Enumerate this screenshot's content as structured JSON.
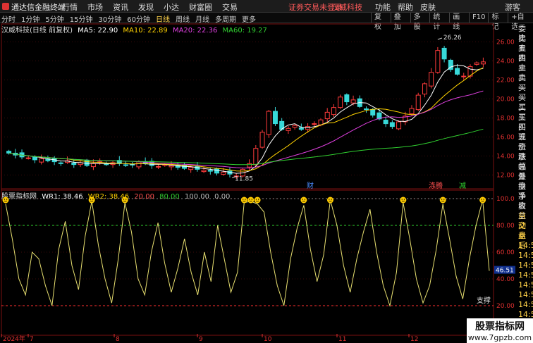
{
  "topbar": {
    "brand": "通达信金融终端",
    "menu": [
      "行情",
      "市场",
      "资讯",
      "发现",
      "小达",
      "财富圈",
      "交易"
    ],
    "notice": "证券交易未登录",
    "stock_name": "汉威科技",
    "right_menu": [
      "功能",
      "帮助",
      "皮肤"
    ],
    "guest": "游客"
  },
  "toolbar": {
    "periods": [
      "分时",
      "1分钟",
      "5分钟",
      "15分钟",
      "30分钟",
      "60分钟",
      "日线",
      "周线",
      "月线",
      "多周期",
      "更多"
    ],
    "active_period": "日线",
    "tools": [
      "复权",
      "叠加",
      "多股",
      "统计",
      "画线",
      "F10",
      "标记",
      "+自选"
    ]
  },
  "main_title": {
    "name": "汉威科技(日线 前复权)",
    "ma5": "MA5: 22.90",
    "ma10": "MA10: 22.89",
    "ma20": "MA20: 22.36",
    "ma60": "MA60: 19.27",
    "ma5_color": "#ffffff",
    "ma10_color": "#ffd200",
    "ma20_color": "#e040e0",
    "ma60_color": "#30d030"
  },
  "osc_title": {
    "name": "股票指标网",
    "wr1": "WR1: 38.46",
    "wr2": "WR2: 38.46",
    "l20": "20.00",
    "l80": "80.00",
    "l100": "100.00",
    "l0": "0.00"
  },
  "axis": {
    "price_ticks": [
      "26.00",
      "24.00",
      "22.00",
      "20.00",
      "18.00",
      "16.00",
      "14.00",
      "12.00"
    ],
    "osc_ticks": [
      "100.0",
      "80.00",
      "60.00",
      "40.00",
      "20.00"
    ],
    "osc_current": "46.51",
    "dates": [
      "2024年",
      "7",
      "8",
      "9",
      "10",
      "11",
      "12"
    ]
  },
  "annotations": {
    "high": "26.26",
    "low": "11.85",
    "cai": "财",
    "chouma": "涤腾",
    "jian": "减",
    "support": "支撑"
  },
  "side_panel": [
    "委比",
    "卖五",
    "卖四",
    "卖三",
    "卖二",
    "卖一",
    "买一",
    "买二",
    "买三",
    "买四",
    "买五",
    "现价",
    "涨跌",
    "涨幅",
    "总量",
    "外盘",
    "换手",
    "净资",
    "收益",
    "自动",
    "交易",
    "盘后",
    "14:5",
    "14:5",
    "14:5",
    "14:5",
    "14:5",
    "14:5",
    "14:5",
    "14:5"
  ],
  "watermark": {
    "line1": "股票指标网",
    "line2": "www.7gpzb.com"
  },
  "chart_data": [
    {
      "type": "candlestick",
      "ylim": [
        11,
        27
      ],
      "x_dates": [
        "2024年",
        "7",
        "8",
        "9",
        "10",
        "11",
        "12"
      ],
      "high": 26.26,
      "low": 11.85,
      "closes": [
        14.3,
        14.1,
        13.9,
        13.8,
        13.6,
        13.7,
        13.5,
        13.4,
        13.2,
        13.5,
        13.1,
        13.3,
        13.0,
        13.2,
        13.4,
        13.1,
        13.3,
        13.2,
        13.0,
        13.1,
        13.4,
        13.2,
        13.0,
        12.9,
        13.1,
        13.0,
        12.8,
        12.7,
        12.8,
        12.6,
        12.5,
        12.4,
        12.2,
        12.3,
        12.1,
        11.9,
        12.6,
        13.2,
        14.8,
        16.5,
        18.7,
        17.4,
        16.8,
        16.9,
        17.2,
        16.8,
        17.1,
        17.4,
        17.8,
        18.6,
        19.1,
        20.2,
        19.7,
        19.9,
        19.2,
        18.9,
        18.3,
        17.9,
        17.4,
        17.1,
        17.6,
        18.2,
        19.0,
        20.4,
        21.6,
        22.8,
        25.1,
        24.2,
        23.1,
        22.6,
        22.4,
        23.4,
        23.8,
        23.9
      ],
      "ma5": 22.9,
      "ma10": 22.89,
      "ma20": 22.36,
      "ma60": 19.27
    },
    {
      "type": "line",
      "ylim": [
        0,
        100
      ],
      "series": [
        {
          "name": "WR1",
          "values": [
            96,
            70,
            40,
            28,
            60,
            55,
            35,
            20,
            62,
            83,
            50,
            32,
            72,
            98,
            65,
            40,
            22,
            55,
            97,
            75,
            40,
            28,
            60,
            82,
            52,
            30,
            48,
            70,
            45,
            28,
            60,
            38,
            80,
            55,
            30,
            45,
            97,
            98,
            96,
            90,
            60,
            35,
            20,
            55,
            78,
            95,
            62,
            38,
            58,
            99,
            80,
            50,
            30,
            55,
            75,
            92,
            60,
            35,
            20,
            45,
            97,
            70,
            40,
            22,
            35,
            62,
            96,
            70,
            42,
            25,
            55,
            80,
            99,
            46
          ]
        }
      ]
    }
  ]
}
